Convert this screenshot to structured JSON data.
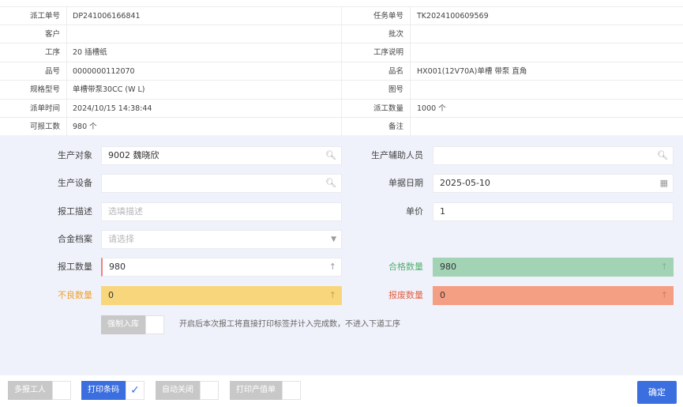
{
  "info": {
    "rows": [
      {
        "l_label": "派工单号",
        "l_value": "DP241006166841",
        "r_label": "任务单号",
        "r_value": "TK2024100609569"
      },
      {
        "l_label": "客户",
        "l_value": "",
        "r_label": "批次",
        "r_value": ""
      },
      {
        "l_label": "工序",
        "l_value": "20 插槽纸",
        "r_label": "工序说明",
        "r_value": ""
      },
      {
        "l_label": "品号",
        "l_value": "0000000112070",
        "r_label": "品名",
        "r_value": "HX001(12V70A)单槽 带泵 直角"
      },
      {
        "l_label": "规格型号",
        "l_value": "单槽带泵30CC (W L)",
        "r_label": "图号",
        "r_value": ""
      },
      {
        "l_label": "派单时间",
        "l_value": "2024/10/15 14:38:44",
        "r_label": "派工数量",
        "r_value": "1000 个"
      },
      {
        "l_label": "可报工数",
        "l_value": "980 个",
        "r_label": "备注",
        "r_value": ""
      }
    ]
  },
  "form": {
    "production_target": {
      "label": "生产对象",
      "value": "9002 魏晓欣"
    },
    "production_assistant": {
      "label": "生产辅助人员",
      "value": ""
    },
    "production_equipment": {
      "label": "生产设备",
      "value": ""
    },
    "document_date": {
      "label": "单据日期",
      "value": "2025-05-10"
    },
    "report_description": {
      "label": "报工描述",
      "placeholder": "选填描述"
    },
    "unit_price": {
      "label": "单价",
      "value": "1"
    },
    "alloy_archive": {
      "label": "合金档案",
      "placeholder": "请选择"
    },
    "report_quantity": {
      "label": "报工数量",
      "value": "980"
    },
    "qualified_quantity": {
      "label": "合格数量",
      "value": "980"
    },
    "defective_quantity": {
      "label": "不良数量",
      "value": "0"
    },
    "scrap_quantity": {
      "label": "报废数量",
      "value": "0"
    },
    "force_stock": {
      "label": "强制入库",
      "note": "开启后本次报工将直接打印标签并计入完成数，不进入下道工序"
    }
  },
  "footer": {
    "multi_reporter": "多报工人",
    "print_barcode": "打印条码",
    "auto_close": "自动关闭",
    "print_output": "打印产值单",
    "confirm": "确定"
  },
  "colors": {
    "accent": "#3b6fe0",
    "qualified": "#a3d3b5",
    "defective": "#f8d67c",
    "scrap": "#f49e83"
  }
}
